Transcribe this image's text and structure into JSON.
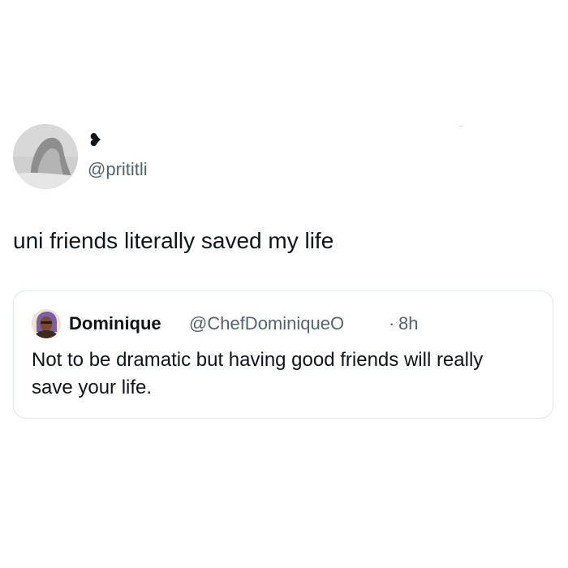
{
  "tweet": {
    "author": {
      "display_name": "❥",
      "handle": "@prititli",
      "avatar_icon": "profile-photo-avatar"
    },
    "text": "uni friends literally saved my life"
  },
  "quoted_tweet": {
    "author": {
      "display_name": "Dominique",
      "handle": "@ChefDominiqueO",
      "avatar_icon": "profile-photo-avatar"
    },
    "separator": "·",
    "time": "8h",
    "text": "Not to be dramatic but having good friends will really save your life."
  },
  "colors": {
    "text_primary": "#0f1419",
    "text_secondary": "#536471",
    "border": "#e4e7ea",
    "background": "#ffffff"
  }
}
